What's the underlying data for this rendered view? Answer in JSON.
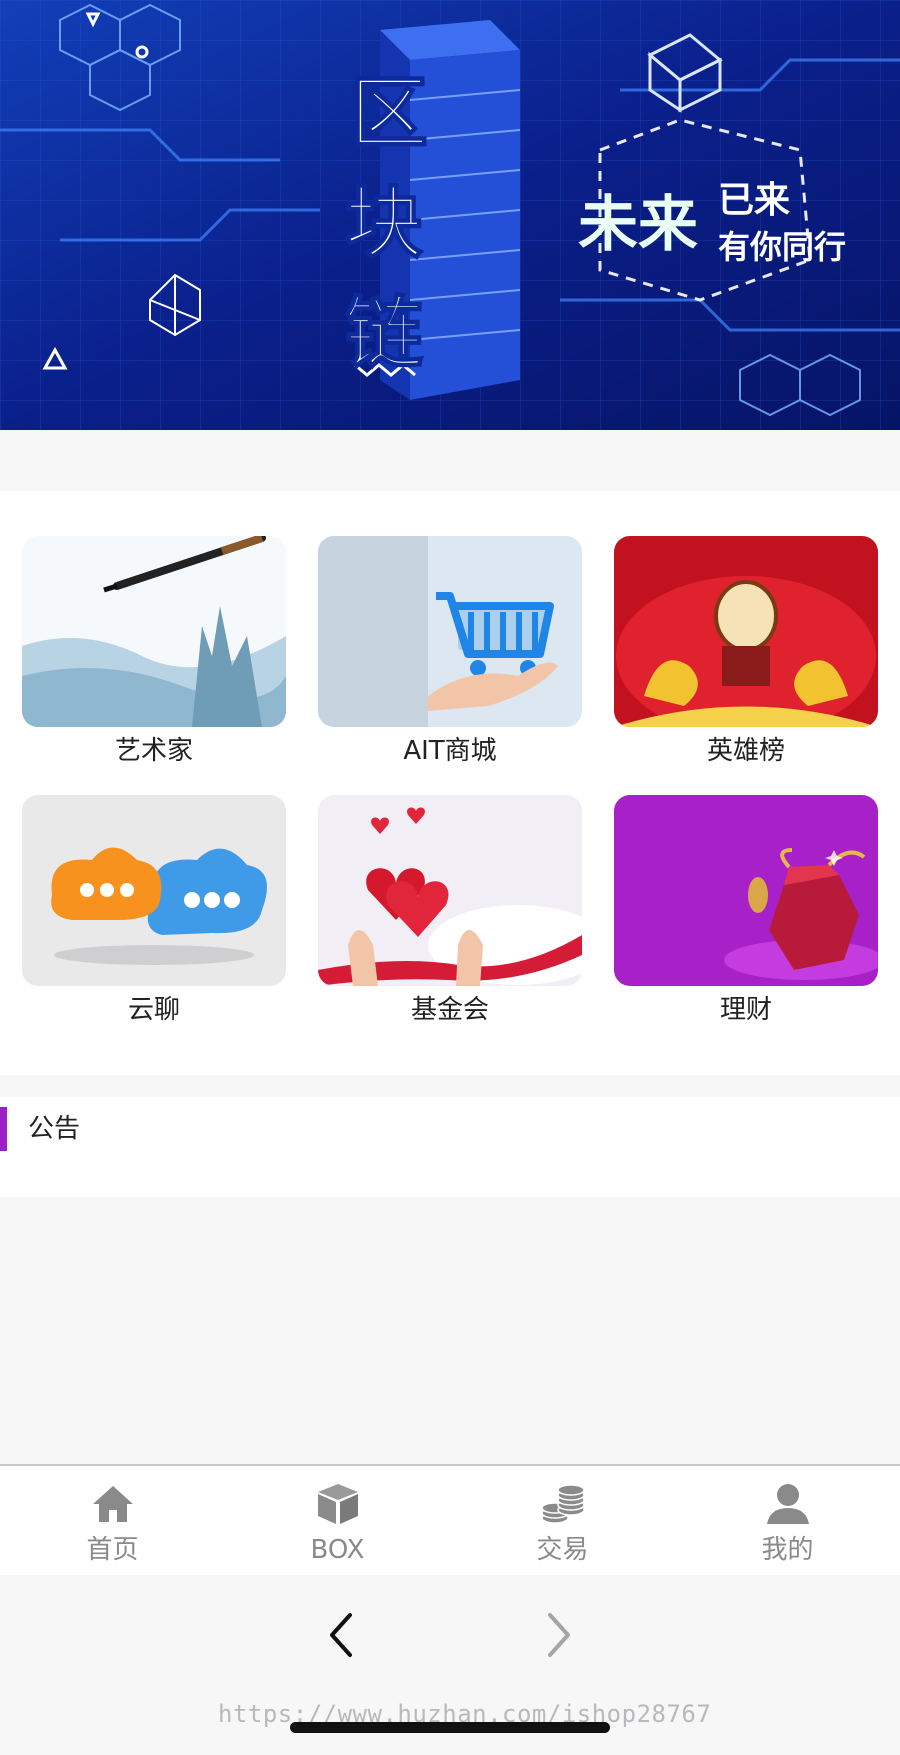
{
  "banner": {
    "headline_vertical": [
      "区",
      "块",
      "链"
    ],
    "slogan_big": "未来",
    "slogan_small_1": "已来",
    "slogan_small_2": "有你同行"
  },
  "grid": {
    "items": [
      {
        "label": "艺术家",
        "image": "ink-painting-brush"
      },
      {
        "label": "AIT商城",
        "image": "shopping-cart-hand"
      },
      {
        "label": "英雄榜",
        "image": "red-drum-gold"
      },
      {
        "label": "云聊",
        "image": "chat-clouds"
      },
      {
        "label": "基金会",
        "image": "hearts-in-hands"
      },
      {
        "label": "理财",
        "image": "money-bag-purple"
      }
    ]
  },
  "notice": {
    "title": "公告"
  },
  "tabbar": {
    "tabs": [
      {
        "label": "首页",
        "icon": "home-icon"
      },
      {
        "label": "BOX",
        "icon": "box-icon"
      },
      {
        "label": "交易",
        "icon": "coins-icon"
      },
      {
        "label": "我的",
        "icon": "user-icon"
      }
    ]
  },
  "browser": {
    "back_icon": "chevron-left-icon",
    "forward_icon": "chevron-right-icon",
    "watermark": "https://www.huzhan.com/ishop28767"
  },
  "colors": {
    "banner_bg": "#0a1f8a",
    "accent_purple": "#9b1fc8",
    "tab_gray": "#8a8a8a"
  }
}
